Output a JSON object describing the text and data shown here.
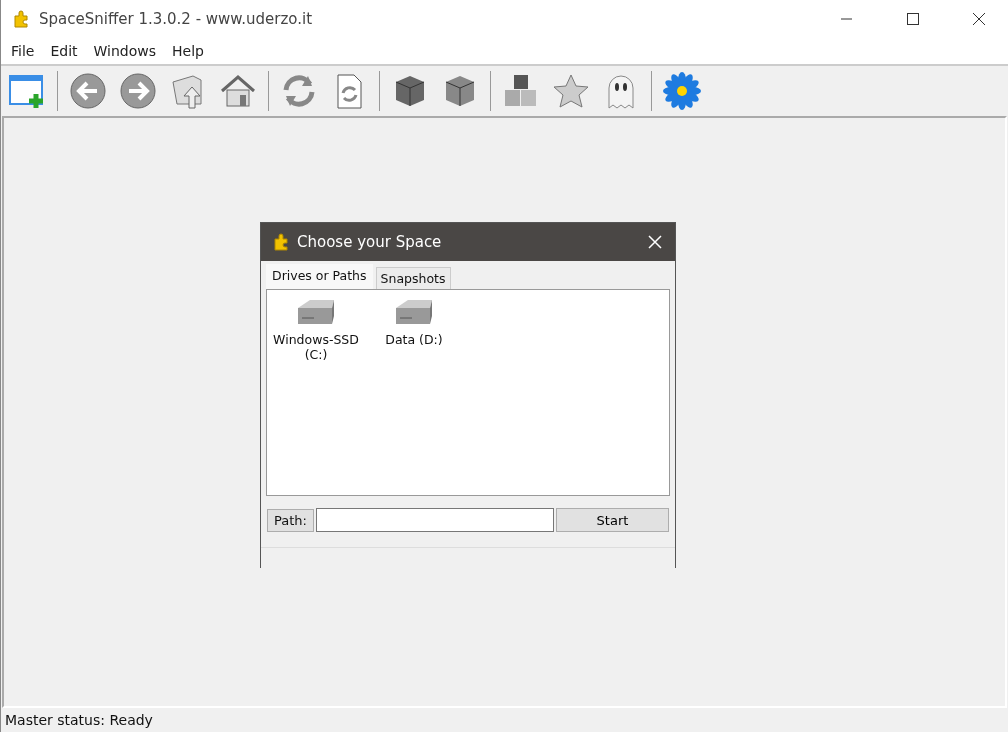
{
  "window": {
    "title": "SpaceSniffer 1.3.0.2 - www.uderzo.it"
  },
  "menu": [
    "File",
    "Edit",
    "Windows",
    "Help"
  ],
  "dialog": {
    "title": "Choose your Space",
    "tabs": [
      {
        "label": "Drives or Paths",
        "selected": true
      },
      {
        "label": "Snapshots",
        "selected": false
      }
    ],
    "drives": [
      {
        "label": "Windows-SSD (C:)"
      },
      {
        "label": "Data (D:)"
      }
    ],
    "path_label": "Path:",
    "start_button": "Start"
  },
  "status_bar": "Master status: Ready"
}
